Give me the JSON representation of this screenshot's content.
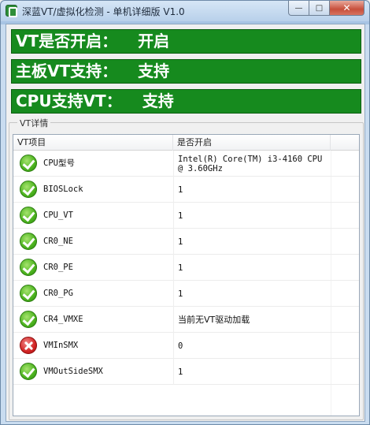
{
  "window": {
    "title": "深蓝VT/虚拟化检测 - 单机详细版 V1.0",
    "min_label": "—",
    "max_label": "□",
    "close_label": "✕"
  },
  "banners": [
    {
      "label": "VT是否开启：",
      "value": "开启"
    },
    {
      "label": "主板VT支持：",
      "value": "支持"
    },
    {
      "label": "CPU支持VT：",
      "value": "支持"
    }
  ],
  "details": {
    "group_label": "VT详情",
    "columns": [
      "VT项目",
      "是否开启",
      ""
    ],
    "rows": [
      {
        "icon": "check-icon",
        "name": "CPU型号",
        "value": "Intel(R) Core(TM) i3-4160 CPU @ 3.60GHz"
      },
      {
        "icon": "check-icon",
        "name": "BIOSLock",
        "value": "1"
      },
      {
        "icon": "check-icon",
        "name": "CPU_VT",
        "value": "1"
      },
      {
        "icon": "check-icon",
        "name": "CR0_NE",
        "value": "1"
      },
      {
        "icon": "check-icon",
        "name": "CR0_PE",
        "value": "1"
      },
      {
        "icon": "check-icon",
        "name": "CR0_PG",
        "value": "1"
      },
      {
        "icon": "check-icon",
        "name": "CR4_VMXE",
        "value": "当前无VT驱动加载"
      },
      {
        "icon": "error-icon",
        "name": "VMInSMX",
        "value": "0"
      },
      {
        "icon": "check-icon",
        "name": "VMOutSideSMX",
        "value": "1"
      }
    ]
  },
  "colors": {
    "banner_green": "#168a1e",
    "ok_green": "#4bb21e",
    "error_red": "#d22424"
  }
}
